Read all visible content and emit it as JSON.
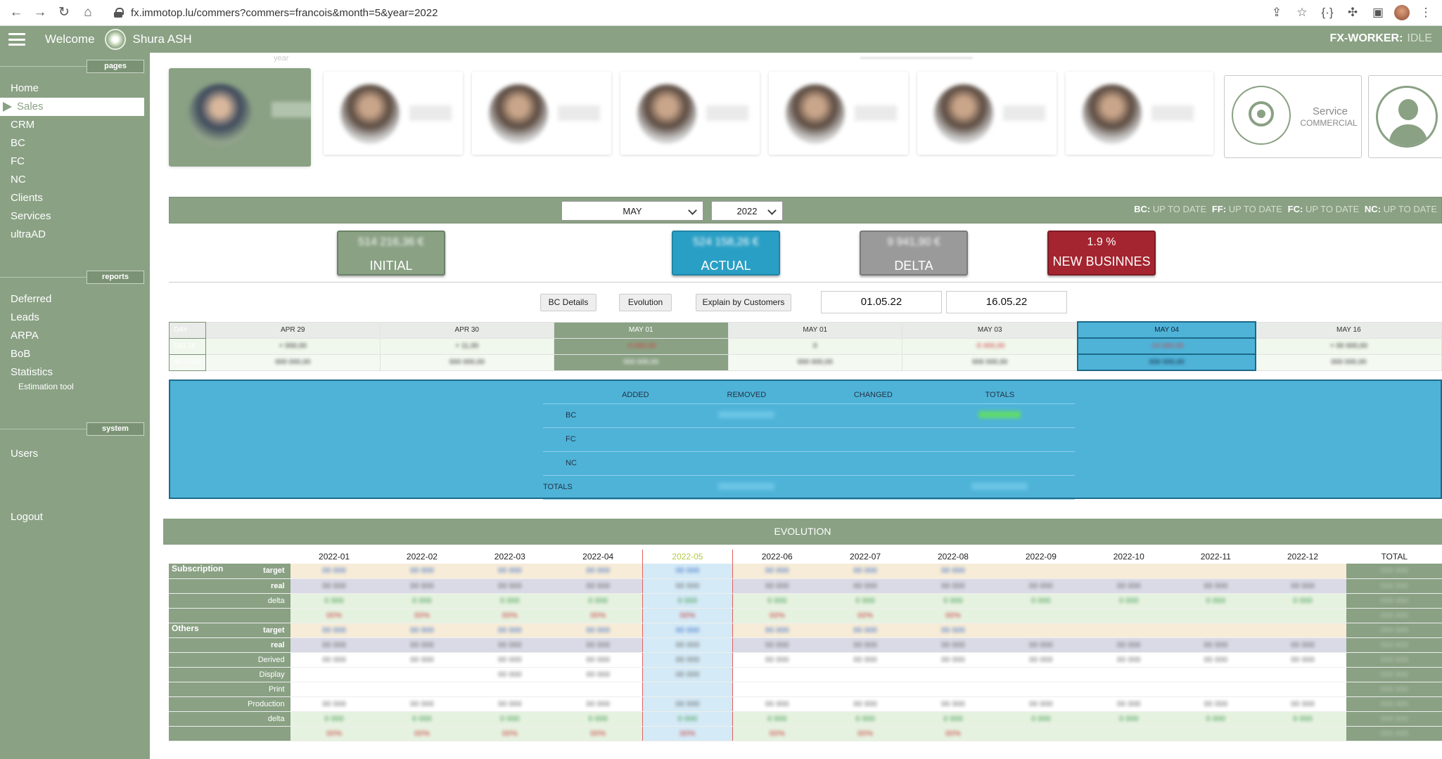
{
  "browser": {
    "url": "fx.immotop.lu/commers?commers=francois&month=5&year=2022"
  },
  "topbar": {
    "welcome": "Welcome",
    "user": "Shura ASH",
    "worker_label": "FX-WORKER:",
    "worker_status": "IDLE"
  },
  "sidebar": {
    "sections": {
      "pages": "pages",
      "reports": "reports",
      "system": "system"
    },
    "pages": [
      "Home",
      "Sales",
      "CRM",
      "BC",
      "FC",
      "NC",
      "Clients",
      "Services",
      "ultraAD"
    ],
    "reports": [
      "Deferred",
      "Leads",
      "ARPA",
      "BoB",
      "Statistics"
    ],
    "reports_sub": "Estimation tool",
    "system": [
      "Users"
    ],
    "logout": "Logout"
  },
  "header": {
    "year_label": "year",
    "service_title": "Service",
    "service_sub": "COMMERCIAL"
  },
  "filters": {
    "month": "MAY",
    "year": "2022",
    "status": [
      {
        "k": "BC:",
        "v": "UP TO DATE"
      },
      {
        "k": "FF:",
        "v": "UP TO DATE"
      },
      {
        "k": "FC:",
        "v": "UP TO DATE"
      },
      {
        "k": "NC:",
        "v": "UP TO DATE"
      }
    ]
  },
  "kpis": {
    "initial": {
      "value": "514 216,36 €",
      "label": "INITIAL"
    },
    "actual": {
      "value": "524 158,26 €",
      "label": "ACTUAL"
    },
    "delta": {
      "value": "9 941,90 €",
      "label": "DELTA"
    },
    "new_business": {
      "value": "1.9 %",
      "label": "NEW BUSINNES"
    }
  },
  "buttons": {
    "bc_details": "BC Details",
    "evolution": "Evolution",
    "explain": "Explain by Customers"
  },
  "dates": {
    "from": "01.05.22",
    "to": "16.05.22"
  },
  "days": {
    "row_labels": [
      "DAY",
      "DELTA",
      "ACTUAL"
    ],
    "columns": [
      "APR 29",
      "APR 30",
      "MAY 01",
      "MAY 01",
      "MAY 03",
      "MAY 04",
      "MAY 16"
    ]
  },
  "detail": {
    "headers": [
      "ADDED",
      "REMOVED",
      "CHANGED",
      "TOTALS"
    ],
    "rows": [
      "BC",
      "FC",
      "NC",
      "TOTALS"
    ]
  },
  "evolution": {
    "title": "EVOLUTION",
    "months": [
      "2022-01",
      "2022-02",
      "2022-03",
      "2022-04",
      "2022-05",
      "2022-06",
      "2022-07",
      "2022-08",
      "2022-09",
      "2022-10",
      "2022-11",
      "2022-12"
    ],
    "total_label": "TOTAL",
    "groups": [
      {
        "name": "Subscription",
        "rows": [
          "target",
          "real",
          "delta",
          ""
        ]
      },
      {
        "name": "Others",
        "rows": [
          "target",
          "real",
          "Derived",
          "Display",
          "Print",
          "Production",
          "delta",
          ""
        ]
      }
    ]
  }
}
